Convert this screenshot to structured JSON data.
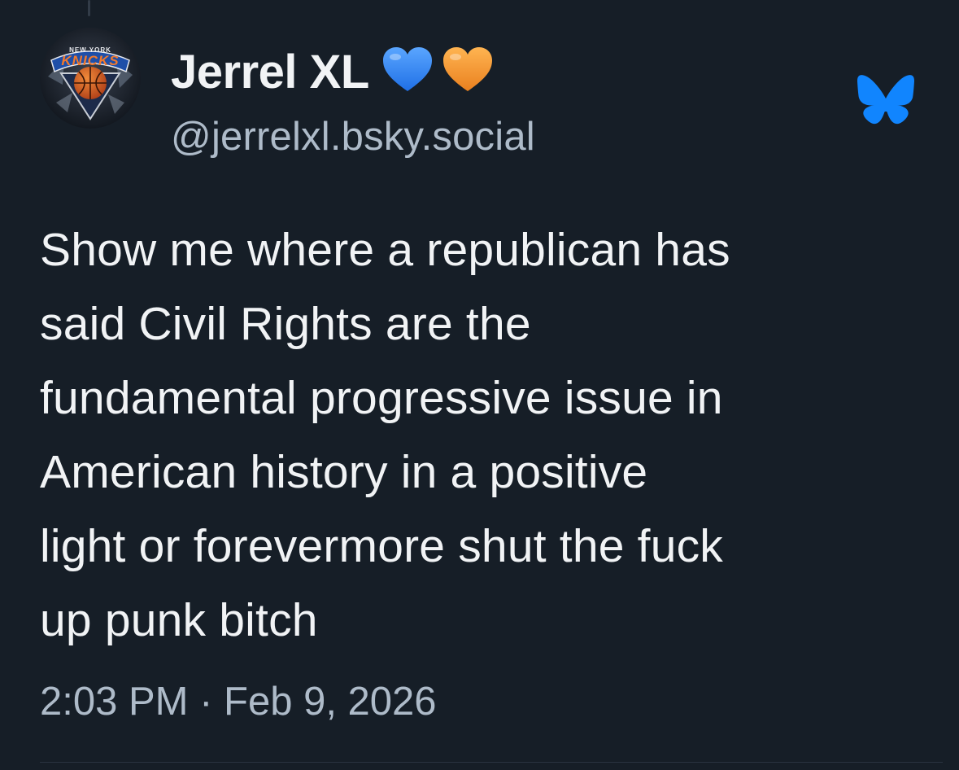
{
  "post": {
    "author": {
      "display_name": "Jerrel XL",
      "handle": "@jerrelxl.bsky.social",
      "name_emojis": [
        "blue-heart",
        "orange-heart"
      ],
      "avatar": {
        "icon": "new-york-knicks-logo",
        "text_top": "NEW YORK",
        "text_main": "KNICKS"
      }
    },
    "text": "Show me where a republican has\nsaid Civil Rights are the\nfundamental progressive issue in\nAmerican history in a positive\nlight or forevermore shut the fuck\nup punk bitch",
    "timestamp": "2:03 PM · Feb 9, 2026"
  },
  "colors": {
    "background": "#161e27",
    "primary_text": "#f1f3f5",
    "secondary_text": "#aebbc9",
    "bluesky_brand": "#1185fe",
    "blue_heart": "#2f86f6",
    "orange_heart": "#f39530"
  },
  "icons": {
    "platform": "bluesky-butterfly-icon"
  }
}
